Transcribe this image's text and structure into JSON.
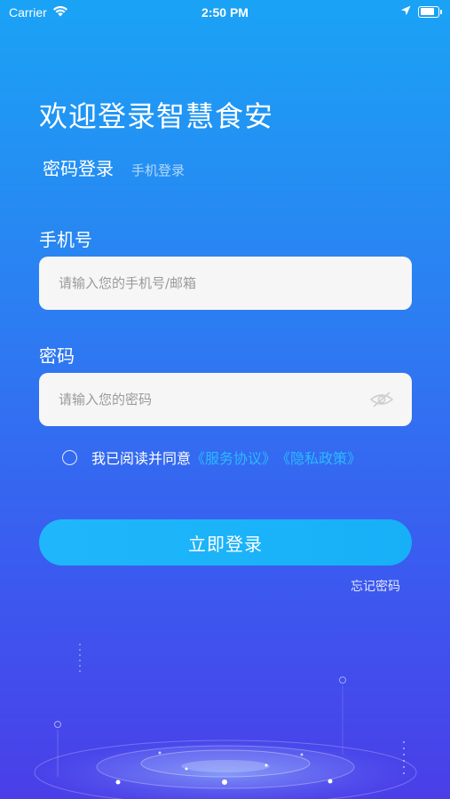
{
  "status_bar": {
    "carrier": "Carrier",
    "time": "2:50 PM",
    "battery_level": 0.95,
    "icons": [
      "wifi-icon",
      "location-arrow-icon",
      "battery-icon"
    ]
  },
  "header": {
    "title": "欢迎登录智慧食安"
  },
  "tabs": [
    {
      "label": "密码登录",
      "active": true
    },
    {
      "label": "手机登录",
      "active": false
    }
  ],
  "form": {
    "phone": {
      "label": "手机号",
      "value": "",
      "placeholder": "请输入您的手机号/邮箱"
    },
    "password": {
      "label": "密码",
      "value": "",
      "placeholder": "请输入您的密码",
      "toggle_icon": "eye-hidden-icon"
    }
  },
  "agreement": {
    "checked": false,
    "text": "我已阅读并同意",
    "service_link": "《服务协议》",
    "privacy_link": "《隐私政策》"
  },
  "actions": {
    "login_label": "立即登录",
    "forgot_label": "忘记密码"
  },
  "colors": {
    "background_top": "#1aa3f5",
    "background_bottom": "#4a3ee8",
    "button": "#20b6fb",
    "link": "#2bb9ff",
    "input_background": "#f6f6f6"
  }
}
